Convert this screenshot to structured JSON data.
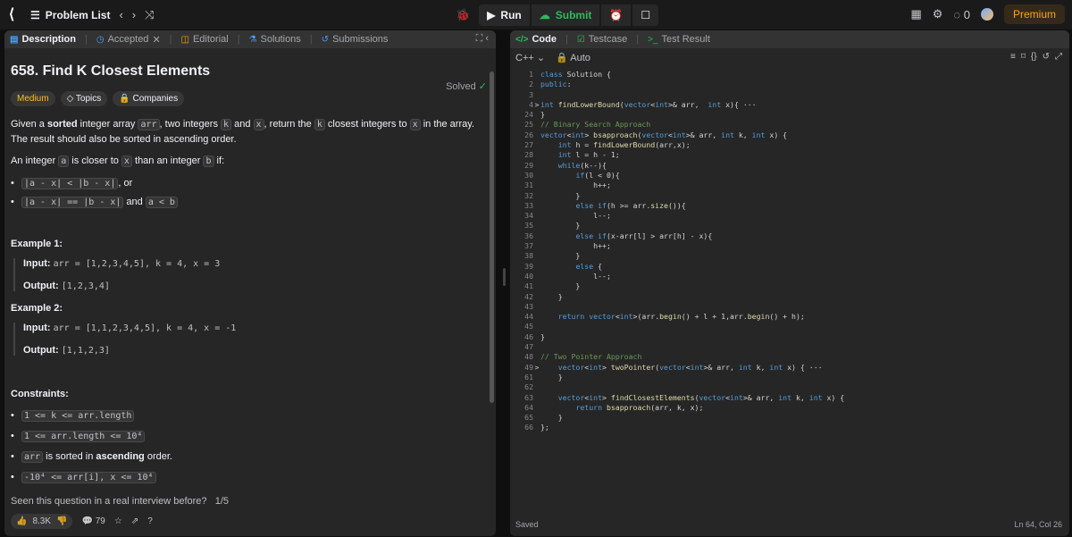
{
  "topbar": {
    "problem_list": "Problem List",
    "run": "Run",
    "submit": "Submit",
    "streak": "0",
    "premium": "Premium"
  },
  "left": {
    "tabs": [
      "Description",
      "Accepted",
      "Editorial",
      "Solutions",
      "Submissions"
    ],
    "title": "658. Find K Closest Elements",
    "solved": "Solved",
    "badges": [
      "Medium",
      "Topics",
      "Companies"
    ],
    "desc": {
      "p1_a": "Given a ",
      "p1_b": "sorted",
      "p1_c": " integer array ",
      "p1_arr": "arr",
      "p1_d": ", two integers ",
      "p1_k": "k",
      "p1_e": " and ",
      "p1_x": "x",
      "p1_f": ", return the ",
      "p1_k2": "k",
      "p1_g": " closest integers to ",
      "p1_x2": "x",
      "p1_h": " in the array. The result should also be sorted in ascending order.",
      "p2_a": "An integer ",
      "p2_a_code": "a",
      "p2_b": " is closer to ",
      "p2_x_code": "x",
      "p2_c": " than an integer ",
      "p2_b_code": "b",
      "p2_d": " if:",
      "c1_code": "|a - x| < |b - x|",
      "c1_text": ", or",
      "c2_code": "|a - x| == |b - x|",
      "c2_text": " and ",
      "c2_code2": "a < b"
    },
    "examples": [
      {
        "title": "Example 1:",
        "input_label": "Input:",
        "input": "arr = [1,2,3,4,5], k = 4, x = 3",
        "output_label": "Output:",
        "output": "[1,2,3,4]"
      },
      {
        "title": "Example 2:",
        "input_label": "Input:",
        "input": "arr = [1,1,2,3,4,5], k = 4, x = -1",
        "output_label": "Output:",
        "output": "[1,1,2,3]"
      }
    ],
    "constraints_title": "Constraints:",
    "constraints": {
      "c1": "1 <= k <= arr.length",
      "c2": "1 <= arr.length <= 10⁴",
      "c3_code": "arr",
      "c3_a": " is sorted in ",
      "c3_b": "ascending",
      "c3_c": " order.",
      "c4": "-10⁴ <= arr[i], x <= 10⁴"
    },
    "interview_q": "Seen this question in a real interview before?",
    "interview_count": "1/5",
    "likes": "8.3K",
    "comments": "79"
  },
  "right": {
    "tabs": [
      "Code",
      "Testcase",
      "Test Result"
    ],
    "lang": "C++",
    "mode": "Auto",
    "status_left": "Saved",
    "status_right": "Ln 64, Col 26",
    "lines": [
      {
        "n": "1",
        "f": "",
        "t": "class Solution {"
      },
      {
        "n": "2",
        "f": "",
        "t": "public:"
      },
      {
        "n": "3",
        "f": "",
        "t": ""
      },
      {
        "n": "4",
        "f": ">",
        "t": "int findLowerBound(vector<int>& arr,  int x){ ···"
      },
      {
        "n": "24",
        "f": "",
        "t": "}"
      },
      {
        "n": "25",
        "f": "",
        "t": "// Binary Search Approach"
      },
      {
        "n": "26",
        "f": "",
        "t": "vector<int> bsapproach(vector<int>& arr, int k, int x) {"
      },
      {
        "n": "27",
        "f": "",
        "t": "    int h = findLowerBound(arr,x);"
      },
      {
        "n": "28",
        "f": "",
        "t": "    int l = h - 1;"
      },
      {
        "n": "29",
        "f": "",
        "t": "    while(k--){"
      },
      {
        "n": "30",
        "f": "",
        "t": "        if(l < 0){"
      },
      {
        "n": "31",
        "f": "",
        "t": "            h++;"
      },
      {
        "n": "32",
        "f": "",
        "t": "        }"
      },
      {
        "n": "33",
        "f": "",
        "t": "        else if(h >= arr.size()){"
      },
      {
        "n": "34",
        "f": "",
        "t": "            l--;"
      },
      {
        "n": "35",
        "f": "",
        "t": "        }"
      },
      {
        "n": "36",
        "f": "",
        "t": "        else if(x-arr[l] > arr[h] - x){"
      },
      {
        "n": "37",
        "f": "",
        "t": "            h++;"
      },
      {
        "n": "38",
        "f": "",
        "t": "        }"
      },
      {
        "n": "39",
        "f": "",
        "t": "        else {"
      },
      {
        "n": "40",
        "f": "",
        "t": "            l--;"
      },
      {
        "n": "41",
        "f": "",
        "t": "        }"
      },
      {
        "n": "42",
        "f": "",
        "t": "    }"
      },
      {
        "n": "43",
        "f": "",
        "t": ""
      },
      {
        "n": "44",
        "f": "",
        "t": "    return vector<int>(arr.begin() + l + 1,arr.begin() + h);"
      },
      {
        "n": "45",
        "f": "",
        "t": ""
      },
      {
        "n": "46",
        "f": "",
        "t": "}"
      },
      {
        "n": "47",
        "f": "",
        "t": ""
      },
      {
        "n": "48",
        "f": "",
        "t": "// Two Pointer Approach"
      },
      {
        "n": "49",
        "f": ">",
        "t": "    vector<int> twoPointer(vector<int>& arr, int k, int x) { ···"
      },
      {
        "n": "61",
        "f": "",
        "t": "    }"
      },
      {
        "n": "62",
        "f": "",
        "t": ""
      },
      {
        "n": "63",
        "f": "",
        "t": "    vector<int> findClosestElements(vector<int>& arr, int k, int x) {"
      },
      {
        "n": "64",
        "f": "",
        "t": "        return bsapproach(arr, k, x);"
      },
      {
        "n": "65",
        "f": "",
        "t": "    }"
      },
      {
        "n": "66",
        "f": "",
        "t": "};"
      }
    ]
  },
  "colors": {
    "accent_green": "#2cbb5d",
    "medium": "#ffc01e",
    "premium": "#ffa116"
  }
}
